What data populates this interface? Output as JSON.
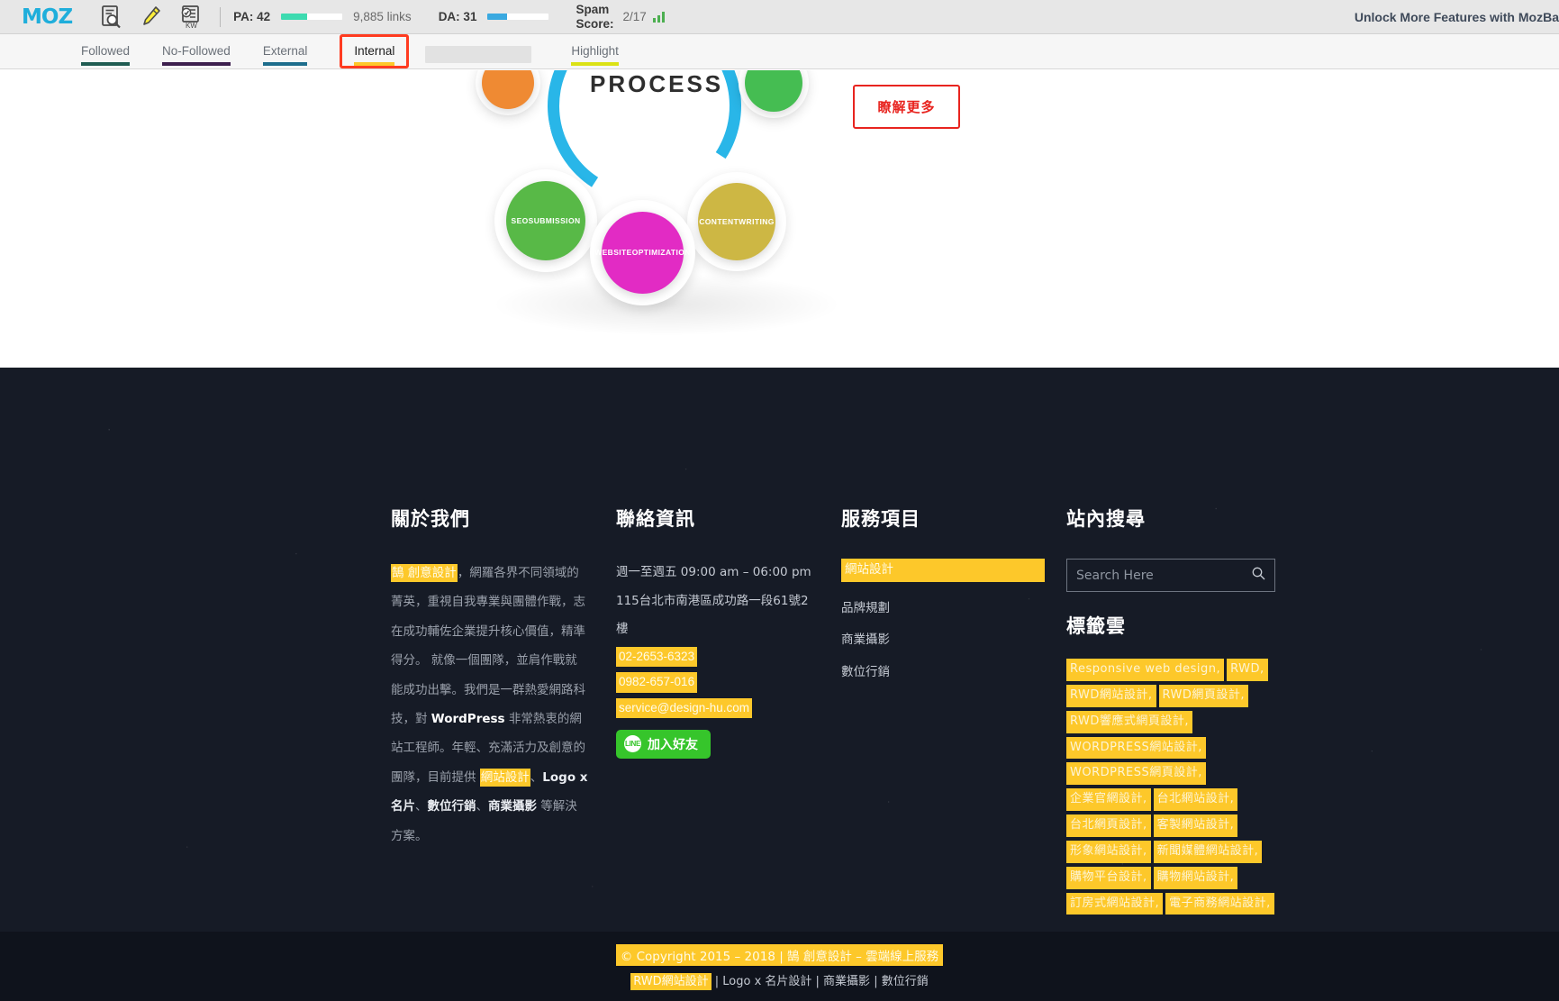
{
  "toolbar": {
    "brand": "MOZ",
    "icons": [
      "page-analysis-icon",
      "highlighter-icon",
      "keyword-icon"
    ],
    "metrics": [
      {
        "name": "pa",
        "label": "PA: 42",
        "bar_color": "#3ddbb0",
        "bar_pct": 42,
        "value": "9,885 links"
      },
      {
        "name": "da",
        "label": "DA: 31",
        "bar_color": "#3aa9e0",
        "bar_pct": 31,
        "value": ""
      }
    ],
    "spam": {
      "label_line1": "Spam",
      "label_line2": "Score:",
      "value": "2/17"
    },
    "unlock_cta": "Unlock More Features with MozBa"
  },
  "subnav": {
    "items": [
      {
        "label": "Followed",
        "color": "#1f5c52",
        "active": false
      },
      {
        "label": "No-Followed",
        "color": "#3d1f4e",
        "active": false
      },
      {
        "label": "External",
        "color": "#1d6d8c",
        "active": false
      },
      {
        "label": "Internal",
        "color": "#fdc82a",
        "active": true
      },
      {
        "label": "Highlight",
        "color": "#dbe215",
        "active": false
      }
    ],
    "highlight_border_color": "#ff3b20"
  },
  "hero": {
    "title": "PROCESS",
    "bubbles": [
      {
        "label": "SEO\nSUBMISSION",
        "color": "#58b947"
      },
      {
        "label": "CONTENT\nWRITING",
        "color": "#cdb744"
      },
      {
        "label": "WEBSITE\nOPTIMIZATION",
        "color": "#e22bc4"
      },
      {
        "label": "",
        "color": "#ef8a33"
      },
      {
        "label": "",
        "color": "#45bd52"
      }
    ],
    "cta_label": "瞭解更多",
    "cta_color": "#e8241f"
  },
  "footer": {
    "about": {
      "title": "關於我們",
      "link_text": "鵠 創意設計",
      "body_part1": "，網羅各界不同領域的菁英，重視自我專業與團體作戰，志在成功輔佐企業提升核心價值，精準得分。 就像一個團隊，並肩作戰就能成功出擊。我們是一群熱愛網路科技，對 ",
      "wordpress": "WordPress",
      "body_part2": " 非常熱衷的網站工程師。年輕、充滿活力及創意的團隊，目前提供 ",
      "link2": "網站設計",
      "body_part3": "、",
      "bold1": "Logo x 名片",
      "body_part4": "、",
      "bold2": "數位行銷",
      "body_part5": "、",
      "bold3": "商業攝影",
      "body_part6": " 等解決方案。"
    },
    "contact": {
      "title": "聯絡資訊",
      "hours": "週一至週五 09:00 am – 06:00 pm",
      "address": "115台北市南港區成功路一段61號2樓",
      "phone": "02-2653-6323",
      "mobile": "0982-657-016",
      "email": "service@design-hu.com",
      "line_badge": "LINE",
      "line_label": "加入好友"
    },
    "services": {
      "title": "服務項目",
      "items": [
        "網站設計",
        "品牌規劃",
        "商業攝影",
        "數位行銷"
      ]
    },
    "search": {
      "title": "站內搜尋",
      "placeholder": "Search Here",
      "value": "",
      "icon": "search-icon",
      "tags_title": "標籤雲",
      "tags": [
        "Responsive web design,",
        "RWD,",
        "RWD網站設計,",
        "RWD網頁設計,",
        "RWD響應式網頁設計,",
        "WORDPRESS網站設計,",
        "WORDPRESS網頁設計,",
        "企業官網設計,",
        "台北網站設計,",
        "台北網頁設計,",
        "客製網站設計,",
        "形象網站設計,",
        "新聞媒體網站設計,",
        "購物平台設計,",
        "購物網站設計,",
        "訂房式網站設計,",
        "電子商務網站設計,"
      ]
    }
  },
  "copyright": {
    "line1": "© Copyright 2015 – 2018 | 鵠 創意設計 – 雲端線上服務",
    "line2_hl": "RWD網站設計",
    "line2_rest": " | Logo x 名片設計 | 商業攝影 | 數位行銷"
  }
}
